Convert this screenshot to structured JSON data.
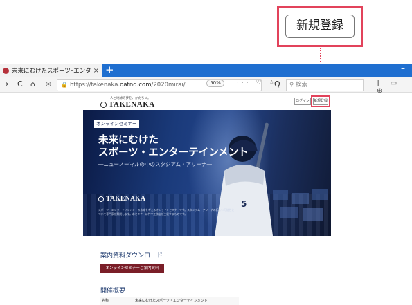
{
  "callout": {
    "label": "新規登録",
    "accent_color": "#e2435b"
  },
  "browser": {
    "tab_title": "未来にむけたスポーツ･エンターテイ",
    "tab_close": "×",
    "new_tab": "+",
    "minimize": "–",
    "nav": {
      "back": "→",
      "reload": "C",
      "home": "⌂",
      "shield": "◎",
      "lock": "🔒"
    },
    "url_host": "https://takenaka.",
    "url_domain": "oatnd.com",
    "url_path": "/2020mirai/",
    "zoom": "50%",
    "url_icons": "··· ♡ ☆",
    "search_placeholder": "検索",
    "search_icon": "Q",
    "right_icons": "⫼ ▭ ⊕"
  },
  "page": {
    "logo_tagline": "人と地球の夢を、かたちに。",
    "logo_text": "TAKENAKA",
    "login_button": "ログイン",
    "register_button": "新規登録",
    "hero": {
      "badge": "オンラインセミナー",
      "title_line1": "未来にむけた",
      "title_line2": "スポーツ・エンターテインメント",
      "subtitle": "―ニューノーマルの中のスタジアム・アリーナ―",
      "logo_text": "TAKENAKA",
      "description": "スポーツ・エンターテインメントの未来を考えるオンラインセミナーです。スタジアム・アリーナの新しい可能性について専門家が解説します。本セミナーは竹中工務店が主催するものです。",
      "colors": {
        "primary": "#1a3a7a",
        "dark": "#0b1a45"
      }
    },
    "download": {
      "heading": "案内資料ダウンロード",
      "button": "オンラインセミナーご案内資料",
      "button_color": "#7a1e28"
    },
    "overview": {
      "heading": "開催概要",
      "rows": [
        {
          "label": "名称",
          "value": "未来にむけたスポーツ・エンターテインメント"
        }
      ]
    }
  }
}
